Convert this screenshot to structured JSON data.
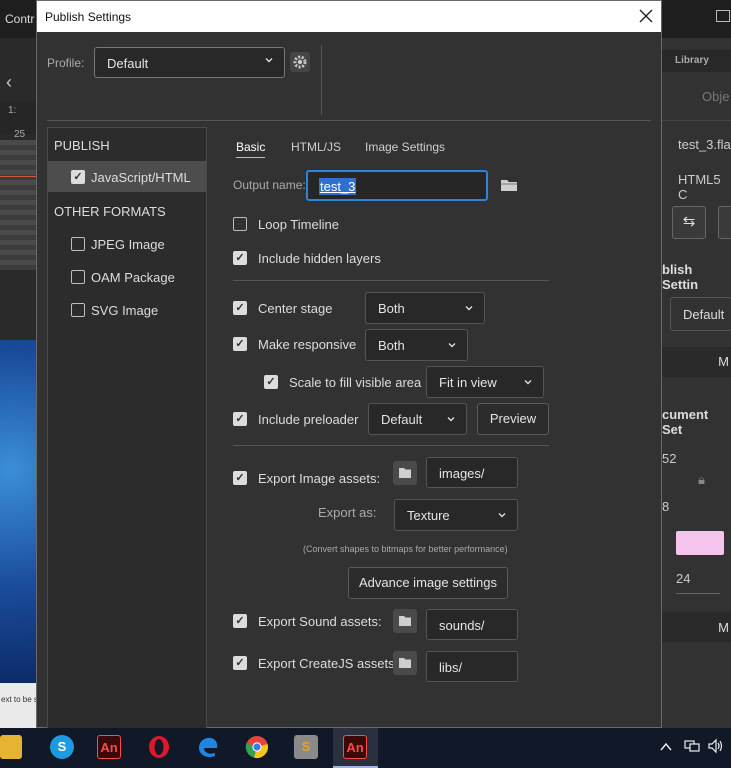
{
  "background": {
    "control_label": "Contr",
    "ruler_number": "25",
    "library_tab": "Library",
    "object_label": "Obje",
    "filename": "test_3.fla",
    "html5_label": "HTML5 C",
    "publish_settings_label": "blish Settin",
    "profile_value": "Default",
    "more_label_1": "M",
    "document_settings_label": "cument Set",
    "width_value": "52",
    "height_value": "8",
    "fps_value": "24",
    "more_label_2": "M",
    "stage_text": "ext to be s…",
    "stage_color": "#f4c4ef"
  },
  "dialog": {
    "title": "Publish Settings",
    "close_icon": "close-icon",
    "profile_label": "Profile:",
    "profile_value": "Default",
    "gear_icon": "gear-icon",
    "sidebar": {
      "publish_header": "PUBLISH",
      "publish_items": [
        {
          "label": "JavaScript/HTML",
          "checked": true
        }
      ],
      "other_header": "OTHER FORMATS",
      "other_items": [
        {
          "label": "JPEG Image",
          "checked": false
        },
        {
          "label": "OAM Package",
          "checked": false
        },
        {
          "label": "SVG Image",
          "checked": false
        }
      ]
    },
    "tabs": [
      "Basic",
      "HTML/JS",
      "Image Settings"
    ],
    "active_tab": "Basic",
    "output_name_label": "Output name:",
    "output_name_value": "test_3",
    "options": {
      "loop_timeline": "Loop Timeline",
      "include_hidden_layers": "Include hidden layers",
      "center_stage": "Center stage",
      "center_stage_value": "Both",
      "make_responsive": "Make responsive",
      "make_responsive_value": "Both",
      "scale_to_fill": "Scale to fill visible area",
      "scale_to_fill_value": "Fit in view",
      "include_preloader": "Include preloader",
      "include_preloader_value": "Default",
      "preview_button": "Preview"
    },
    "checks": {
      "loop_timeline": false,
      "include_hidden_layers": true,
      "center_stage": true,
      "make_responsive": true,
      "scale_to_fill": true,
      "include_preloader": true,
      "export_image": true,
      "export_sound": true,
      "export_createjs": true
    },
    "assets": {
      "export_image_label": "Export Image assets:",
      "export_image_path": "images/",
      "export_as_label": "Export as:",
      "export_as_value": "Texture",
      "hint": "(Convert shapes to bitmaps for better performance)",
      "advance_button": "Advance image settings",
      "export_sound_label": "Export Sound assets:",
      "export_sound_path": "sounds/",
      "export_createjs_label": "Export CreateJS assets:",
      "export_createjs_path": "libs/"
    }
  },
  "taskbar": {
    "icons": [
      "file-explorer-icon",
      "skype-icon",
      "animate-icon",
      "opera-icon",
      "edge-icon",
      "chrome-icon",
      "sublime-icon",
      "animate-active-icon"
    ],
    "icon_labels": {
      "skype": "S",
      "animate": "An",
      "sublime": "S"
    },
    "tray_icons": [
      "chevron-up-icon",
      "network-icon",
      "volume-icon"
    ]
  }
}
